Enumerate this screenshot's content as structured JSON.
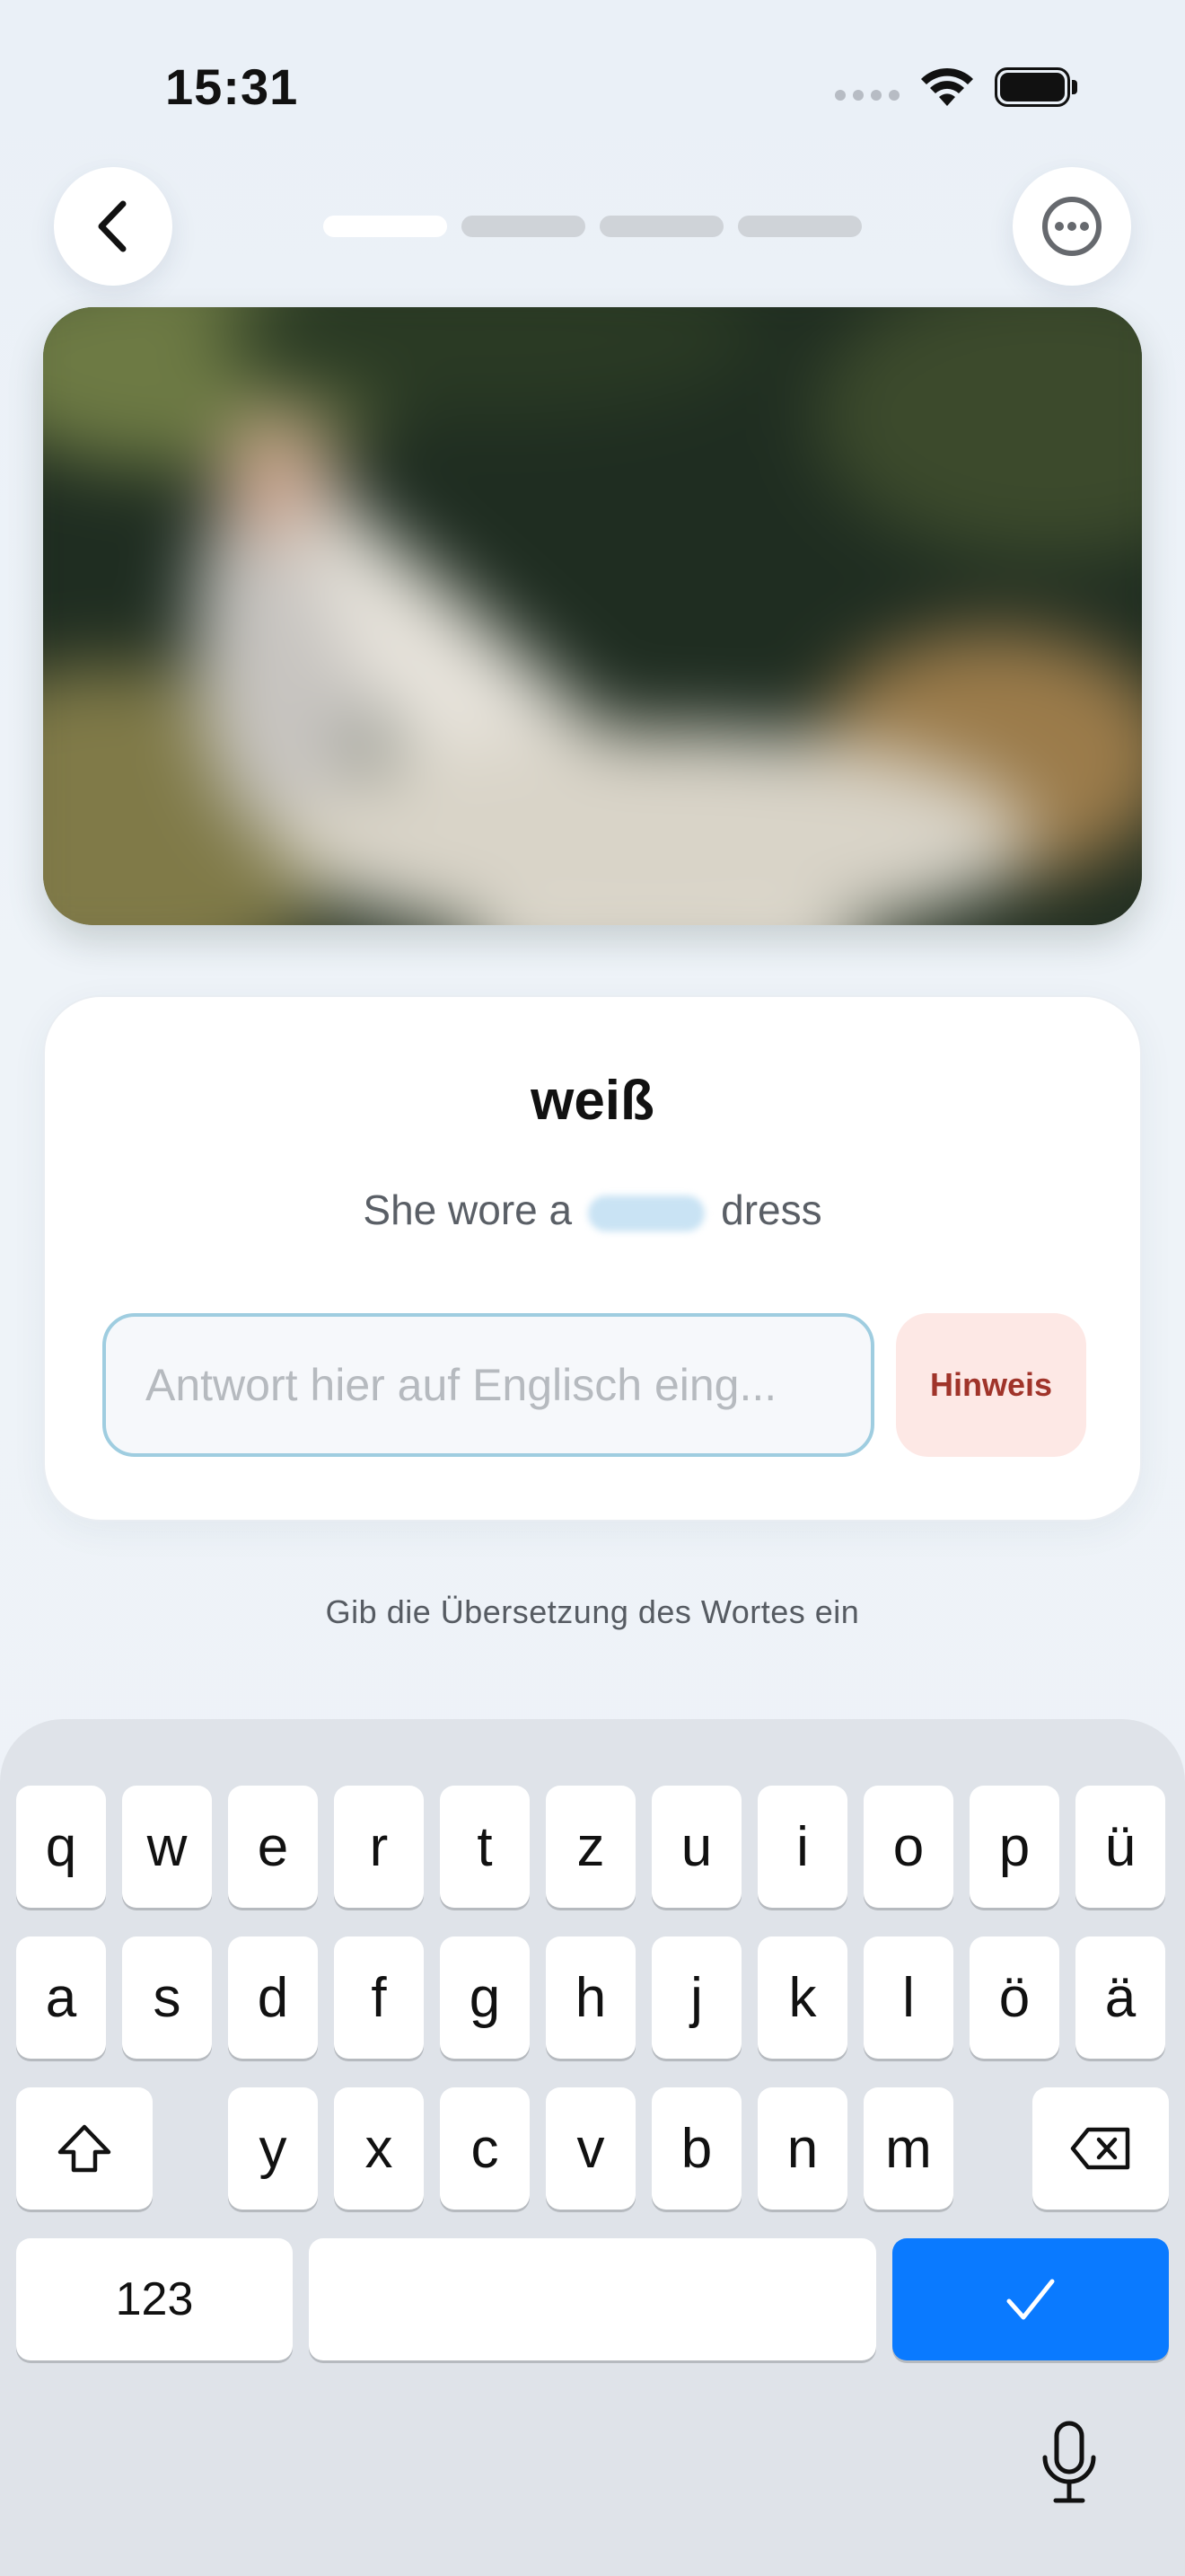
{
  "status_bar": {
    "time": "15:31"
  },
  "progress": {
    "total_segments": 4,
    "active_index": 0
  },
  "photo": {
    "alt": ""
  },
  "quiz": {
    "word": "weiß",
    "sentence_before": "She wore a",
    "sentence_after": "dress",
    "input_placeholder": "Antwort hier auf Englisch eing...",
    "hint_label": "Hinweis"
  },
  "instruction": "Gib die Übersetzung des Wortes ein",
  "keyboard": {
    "row1": [
      "q",
      "w",
      "e",
      "r",
      "t",
      "z",
      "u",
      "i",
      "o",
      "p",
      "ü"
    ],
    "row2": [
      "a",
      "s",
      "d",
      "f",
      "g",
      "h",
      "j",
      "k",
      "l",
      "ö",
      "ä"
    ],
    "row3": [
      "y",
      "x",
      "c",
      "v",
      "b",
      "n",
      "m"
    ],
    "numbers_label": "123"
  },
  "colors": {
    "accent": "#0a7aff",
    "hint_bg": "#fde8e5",
    "hint_text": "#a0342a",
    "input_border": "#9fcde0"
  },
  "icons": [
    "back-chevron-icon",
    "more-ellipsis-icon",
    "wifi-icon",
    "battery-icon",
    "shift-icon",
    "backspace-icon",
    "checkmark-icon",
    "microphone-icon"
  ]
}
